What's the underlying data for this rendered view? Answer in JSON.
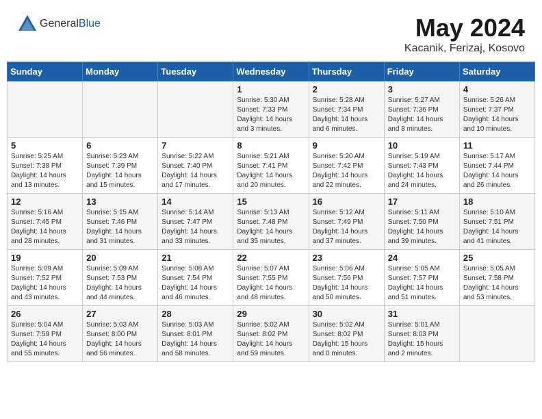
{
  "header": {
    "logo_general": "General",
    "logo_blue": "Blue",
    "month_title": "May 2024",
    "location": "Kacanik, Ferizaj, Kosovo"
  },
  "weekdays": [
    "Sunday",
    "Monday",
    "Tuesday",
    "Wednesday",
    "Thursday",
    "Friday",
    "Saturday"
  ],
  "weeks": [
    [
      {
        "day": "",
        "content": ""
      },
      {
        "day": "",
        "content": ""
      },
      {
        "day": "",
        "content": ""
      },
      {
        "day": "1",
        "content": "Sunrise: 5:30 AM\nSunset: 7:33 PM\nDaylight: 14 hours\nand 3 minutes."
      },
      {
        "day": "2",
        "content": "Sunrise: 5:28 AM\nSunset: 7:34 PM\nDaylight: 14 hours\nand 6 minutes."
      },
      {
        "day": "3",
        "content": "Sunrise: 5:27 AM\nSunset: 7:36 PM\nDaylight: 14 hours\nand 8 minutes."
      },
      {
        "day": "4",
        "content": "Sunrise: 5:26 AM\nSunset: 7:37 PM\nDaylight: 14 hours\nand 10 minutes."
      }
    ],
    [
      {
        "day": "5",
        "content": "Sunrise: 5:25 AM\nSunset: 7:38 PM\nDaylight: 14 hours\nand 13 minutes."
      },
      {
        "day": "6",
        "content": "Sunrise: 5:23 AM\nSunset: 7:39 PM\nDaylight: 14 hours\nand 15 minutes."
      },
      {
        "day": "7",
        "content": "Sunrise: 5:22 AM\nSunset: 7:40 PM\nDaylight: 14 hours\nand 17 minutes."
      },
      {
        "day": "8",
        "content": "Sunrise: 5:21 AM\nSunset: 7:41 PM\nDaylight: 14 hours\nand 20 minutes."
      },
      {
        "day": "9",
        "content": "Sunrise: 5:20 AM\nSunset: 7:42 PM\nDaylight: 14 hours\nand 22 minutes."
      },
      {
        "day": "10",
        "content": "Sunrise: 5:19 AM\nSunset: 7:43 PM\nDaylight: 14 hours\nand 24 minutes."
      },
      {
        "day": "11",
        "content": "Sunrise: 5:17 AM\nSunset: 7:44 PM\nDaylight: 14 hours\nand 26 minutes."
      }
    ],
    [
      {
        "day": "12",
        "content": "Sunrise: 5:16 AM\nSunset: 7:45 PM\nDaylight: 14 hours\nand 28 minutes."
      },
      {
        "day": "13",
        "content": "Sunrise: 5:15 AM\nSunset: 7:46 PM\nDaylight: 14 hours\nand 31 minutes."
      },
      {
        "day": "14",
        "content": "Sunrise: 5:14 AM\nSunset: 7:47 PM\nDaylight: 14 hours\nand 33 minutes."
      },
      {
        "day": "15",
        "content": "Sunrise: 5:13 AM\nSunset: 7:48 PM\nDaylight: 14 hours\nand 35 minutes."
      },
      {
        "day": "16",
        "content": "Sunrise: 5:12 AM\nSunset: 7:49 PM\nDaylight: 14 hours\nand 37 minutes."
      },
      {
        "day": "17",
        "content": "Sunrise: 5:11 AM\nSunset: 7:50 PM\nDaylight: 14 hours\nand 39 minutes."
      },
      {
        "day": "18",
        "content": "Sunrise: 5:10 AM\nSunset: 7:51 PM\nDaylight: 14 hours\nand 41 minutes."
      }
    ],
    [
      {
        "day": "19",
        "content": "Sunrise: 5:09 AM\nSunset: 7:52 PM\nDaylight: 14 hours\nand 43 minutes."
      },
      {
        "day": "20",
        "content": "Sunrise: 5:09 AM\nSunset: 7:53 PM\nDaylight: 14 hours\nand 44 minutes."
      },
      {
        "day": "21",
        "content": "Sunrise: 5:08 AM\nSunset: 7:54 PM\nDaylight: 14 hours\nand 46 minutes."
      },
      {
        "day": "22",
        "content": "Sunrise: 5:07 AM\nSunset: 7:55 PM\nDaylight: 14 hours\nand 48 minutes."
      },
      {
        "day": "23",
        "content": "Sunrise: 5:06 AM\nSunset: 7:56 PM\nDaylight: 14 hours\nand 50 minutes."
      },
      {
        "day": "24",
        "content": "Sunrise: 5:05 AM\nSunset: 7:57 PM\nDaylight: 14 hours\nand 51 minutes."
      },
      {
        "day": "25",
        "content": "Sunrise: 5:05 AM\nSunset: 7:58 PM\nDaylight: 14 hours\nand 53 minutes."
      }
    ],
    [
      {
        "day": "26",
        "content": "Sunrise: 5:04 AM\nSunset: 7:59 PM\nDaylight: 14 hours\nand 55 minutes."
      },
      {
        "day": "27",
        "content": "Sunrise: 5:03 AM\nSunset: 8:00 PM\nDaylight: 14 hours\nand 56 minutes."
      },
      {
        "day": "28",
        "content": "Sunrise: 5:03 AM\nSunset: 8:01 PM\nDaylight: 14 hours\nand 58 minutes."
      },
      {
        "day": "29",
        "content": "Sunrise: 5:02 AM\nSunset: 8:02 PM\nDaylight: 14 hours\nand 59 minutes."
      },
      {
        "day": "30",
        "content": "Sunrise: 5:02 AM\nSunset: 8:02 PM\nDaylight: 15 hours\nand 0 minutes."
      },
      {
        "day": "31",
        "content": "Sunrise: 5:01 AM\nSunset: 8:03 PM\nDaylight: 15 hours\nand 2 minutes."
      },
      {
        "day": "",
        "content": ""
      }
    ]
  ]
}
